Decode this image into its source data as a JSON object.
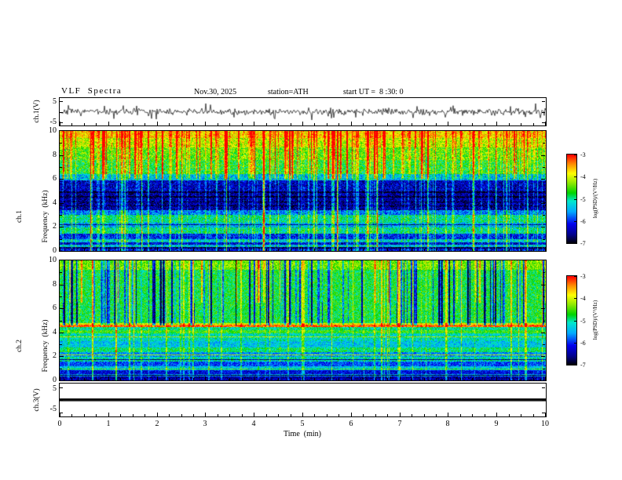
{
  "colors": {
    "foreground": "#000000",
    "background": "#ffffff",
    "colormap_stops": [
      [
        0.0,
        "#000000"
      ],
      [
        0.1,
        "#00008b"
      ],
      [
        0.22,
        "#0000ee"
      ],
      [
        0.36,
        "#00aaff"
      ],
      [
        0.48,
        "#00e8cc"
      ],
      [
        0.57,
        "#00d400"
      ],
      [
        0.68,
        "#8ce800"
      ],
      [
        0.79,
        "#ffff00"
      ],
      [
        0.9,
        "#ff8800"
      ],
      [
        1.0,
        "#ff0000"
      ]
    ]
  },
  "title": {
    "main": "VLF  Spectra",
    "date": "Nov.30, 2025",
    "station": "station=ATH",
    "start_ut": "start UT =  8 :30: 0"
  },
  "left_labels": {
    "ch1_wave": "ch.1(V)",
    "ch1_spec_ch": "ch.1",
    "ch1_spec_freq": "Frequency  (kHz)",
    "ch2_spec_ch": "ch.2",
    "ch2_spec_freq": "Frequency  (kHz)",
    "ch3_wave": "ch.3(V)"
  },
  "yaxis": {
    "wave_top": "5",
    "wave_bottom": "-5",
    "spec_ticks": [
      "10",
      "8",
      "6",
      "4",
      "2",
      "0"
    ]
  },
  "xaxis": {
    "label": "Time  (min)",
    "ticks": [
      "0",
      "1",
      "2",
      "3",
      "4",
      "5",
      "6",
      "7",
      "8",
      "9",
      "10"
    ]
  },
  "colorbar": {
    "label": "log(PSD)/(V²/Hz)",
    "ticks": [
      "-3",
      "-4",
      "-5",
      "-6",
      "-7"
    ]
  },
  "chart_data": [
    {
      "id": "ch1_waveform",
      "type": "line",
      "panel_label": "ch.1(V)",
      "xlim": [
        0,
        10
      ],
      "ylim": [
        -5,
        5
      ],
      "description": "continuous broadband noise trace centered on 0 V, typical excursions about ±1.5 V with frequent impulsive spikes reaching about ±4 V over the full 10 minutes",
      "seed": 7,
      "amplitude": 1.1,
      "spike_rate": 0.08,
      "spike_amp": 3.0
    },
    {
      "id": "ch1_spectrogram",
      "type": "heatmap",
      "xlabel": "Time (min)",
      "ylabel": "Frequency (kHz)",
      "zlabel": "log(PSD)/(V²/Hz)",
      "xlim": [
        0,
        10
      ],
      "ylim": [
        0,
        10
      ],
      "zlim": [
        -7,
        -3
      ],
      "seed": 11,
      "noise": 0.55,
      "bands": [
        [
          9.4,
          10.01,
          -3.75
        ],
        [
          8.6,
          9.4,
          -4.1
        ],
        [
          7.6,
          8.6,
          -4.45
        ],
        [
          6.4,
          7.6,
          -4.7
        ],
        [
          5.9,
          6.4,
          -5.4
        ],
        [
          5.0,
          5.9,
          -6.35
        ],
        [
          3.4,
          5.0,
          -6.5
        ],
        [
          3.0,
          3.4,
          -5.7
        ],
        [
          2.35,
          3.0,
          -5.05
        ],
        [
          1.95,
          2.35,
          -5.5
        ],
        [
          1.45,
          1.95,
          -5.05
        ],
        [
          0.95,
          1.45,
          -6.1
        ],
        [
          0.75,
          0.95,
          -5.3
        ],
        [
          0.55,
          0.75,
          -6.3
        ],
        [
          0.35,
          0.55,
          -5.4
        ],
        [
          0.18,
          0.35,
          -6.8
        ],
        [
          -0.01,
          0.18,
          -6.2
        ]
      ],
      "hlines": [
        [
          3.75,
          -7.0,
          0.05
        ],
        [
          4.1,
          -7.0,
          0.04
        ],
        [
          4.5,
          -7.0,
          0.05
        ],
        [
          4.9,
          -7.0,
          0.04
        ],
        [
          2.2,
          -6.6,
          0.03
        ],
        [
          1.7,
          -6.4,
          0.03
        ]
      ],
      "streaks": [
        {
          "count": 150,
          "fmin": 0,
          "fmax": 10,
          "smin": 0.25,
          "smax": 1.1,
          "wmax": 2
        },
        {
          "count": 90,
          "fmin": 6,
          "fmax": 10,
          "smin": 0.4,
          "smax": 1.7,
          "wmax": 2
        }
      ],
      "description": "PSD highest (-4 to -3, yellow/orange/red) above ~8.5 kHz with dense red sferic tops; green ~-4.7 between 6-8.5 kHz; deep minimum (-6.5, dark blue) 3.4-6 kHz crossed by many narrow vertical broadband sferic streaks; cyan/green bands -5 to -5.5 between 1.4-3.4 kHz; dark speckled rows below 1 kHz; thin dark horizontal interference nulls near 3.8-4.9 kHz"
    },
    {
      "id": "ch2_spectrogram",
      "type": "heatmap",
      "xlabel": "Time (min)",
      "ylabel": "Frequency (kHz)",
      "zlabel": "log(PSD)/(V²/Hz)",
      "xlim": [
        0,
        10
      ],
      "ylim": [
        0,
        10
      ],
      "zlim": [
        -7,
        -3
      ],
      "seed": 23,
      "noise": 0.45,
      "bands": [
        [
          9.2,
          10.01,
          -4.35
        ],
        [
          4.75,
          9.2,
          -4.75
        ],
        [
          4.45,
          4.75,
          -3.9
        ],
        [
          4.2,
          4.45,
          -5.0
        ],
        [
          3.9,
          4.2,
          -4.6
        ],
        [
          3.3,
          3.9,
          -5.15
        ],
        [
          2.75,
          3.3,
          -5.35
        ],
        [
          2.35,
          2.75,
          -4.9
        ],
        [
          1.95,
          2.35,
          -5.6
        ],
        [
          1.55,
          1.95,
          -5.1
        ],
        [
          1.15,
          1.55,
          -5.9
        ],
        [
          0.85,
          1.15,
          -5.35
        ],
        [
          0.55,
          0.85,
          -6.2
        ],
        [
          0.3,
          0.55,
          -5.6
        ],
        [
          -0.01,
          0.3,
          -6.5
        ]
      ],
      "hlines": [
        [
          4.55,
          -3.3,
          0.08
        ],
        [
          3.65,
          -4.2,
          0.03
        ],
        [
          2.15,
          -4.1,
          0.03
        ],
        [
          1.75,
          -6.6,
          0.03
        ],
        [
          0.95,
          -4.6,
          0.02
        ],
        [
          0.45,
          -6.9,
          0.04
        ]
      ],
      "streaks": [
        {
          "count": 110,
          "fmin": 4.6,
          "fmax": 10,
          "smin": -1.9,
          "smax": -0.6,
          "wmax": 2
        },
        {
          "count": 55,
          "fmin": 0,
          "fmax": 10,
          "smin": 0.3,
          "smax": 1.0,
          "wmax": 2
        },
        {
          "count": 25,
          "fmin": 6.5,
          "fmax": 10,
          "smin": 0.5,
          "smax": 1.2,
          "wmax": 2
        }
      ],
      "description": "mostly green (~-4.8) above 4.7 kHz with many narrow dark-blue vertical dropout streaks and some yellow columns; strong red/orange horizontal emission line near 4.5 kHz; layered cyan/green horizontal bands -4.9 to -5.9 between 1-4 kHz with thin orange lines near 2.1 and 3.6 kHz; dark rows (-6.5 and below) under 0.8 kHz"
    },
    {
      "id": "ch3_waveform",
      "type": "line",
      "panel_label": "ch.3(V)",
      "xlim": [
        0,
        10
      ],
      "ylim": [
        -5,
        5
      ],
      "value": 0,
      "description": "completely flat thick black trace at 0 V for the entire 10-minute record"
    }
  ]
}
